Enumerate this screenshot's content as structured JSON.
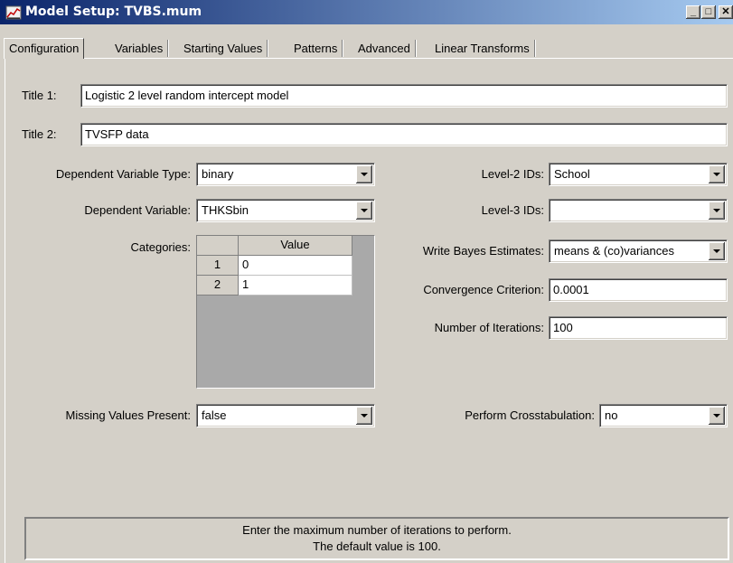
{
  "window": {
    "title": "Model Setup: TVBS.mum",
    "minimize": "_",
    "restore": "□",
    "close": "✕"
  },
  "tabs": [
    {
      "label": "Configuration"
    },
    {
      "label": "Variables"
    },
    {
      "label": "Starting Values"
    },
    {
      "label": "Patterns"
    },
    {
      "label": "Advanced"
    },
    {
      "label": "Linear Transforms"
    }
  ],
  "config": {
    "title1_label": "Title 1:",
    "title1_value": "Logistic 2 level random intercept model",
    "title2_label": "Title 2:",
    "title2_value": "TVSFP data",
    "dep_type_label": "Dependent Variable Type:",
    "dep_type_value": "binary",
    "dep_var_label": "Dependent Variable:",
    "dep_var_value": "THKSbin",
    "categories_label": "Categories:",
    "categories_header": "Value",
    "categories": [
      {
        "index": "1",
        "value": "0"
      },
      {
        "index": "2",
        "value": "1"
      }
    ],
    "missing_label": "Missing Values Present:",
    "missing_value": "false",
    "level2_label": "Level-2 IDs:",
    "level2_value": "School",
    "level3_label": "Level-3 IDs:",
    "level3_value": "",
    "bayes_label": "Write Bayes Estimates:",
    "bayes_value": "means & (co)variances",
    "convergence_label": "Convergence Criterion:",
    "convergence_value": "0.0001",
    "iterations_label": "Number of Iterations:",
    "iterations_value": "100",
    "crosstab_label": "Perform Crosstabulation:",
    "crosstab_value": "no"
  },
  "status": {
    "line1": "Enter the maximum number of iterations to perform.",
    "line2": "The default value is 100."
  }
}
